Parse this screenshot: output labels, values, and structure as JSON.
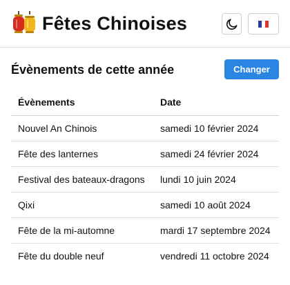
{
  "header": {
    "title": "Fêtes Chinoises",
    "logo_icon": "chinese-lantern-icon",
    "theme_icon": "moon-icon",
    "language_flag": "french-flag-icon"
  },
  "section": {
    "title": "Évènements de cette année",
    "change_button_label": "Changer"
  },
  "table": {
    "headers": [
      "Évènements",
      "Date"
    ],
    "rows": [
      {
        "event": "Nouvel An Chinois",
        "date": "samedi 10 février 2024"
      },
      {
        "event": "Fête des lanternes",
        "date": "samedi 24 février 2024"
      },
      {
        "event": "Festival des bateaux-dragons",
        "date": "lundi 10 juin 2024"
      },
      {
        "event": "Qixi",
        "date": "samedi 10 août 2024"
      },
      {
        "event": "Fête de la mi-automne",
        "date": "mardi 17 septembre 2024"
      },
      {
        "event": "Fête du double neuf",
        "date": "vendredi 11 octobre 2024"
      }
    ]
  },
  "colors": {
    "accent": "#2b86e3",
    "lantern_red": "#d62d20",
    "lantern_gold": "#f2b51b",
    "flag_blue": "#2b3b9c",
    "flag_red": "#e0342c"
  }
}
